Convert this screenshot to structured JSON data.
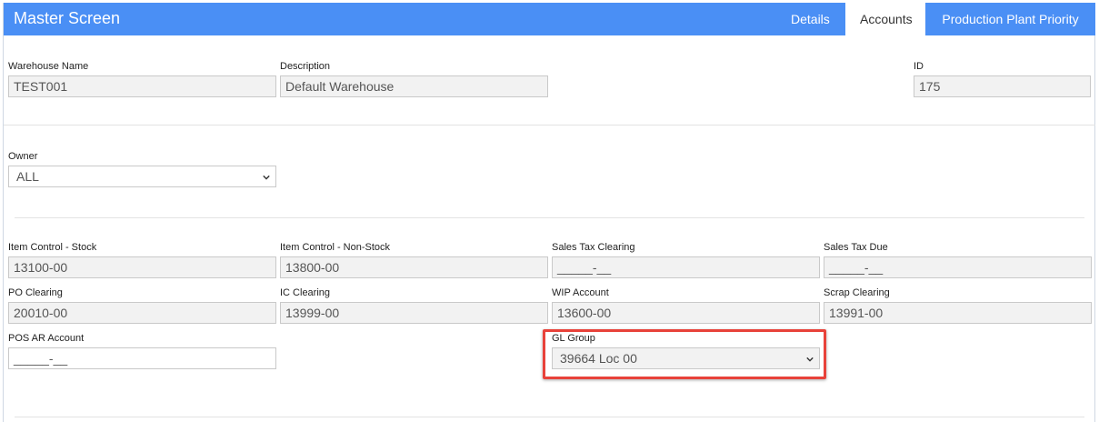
{
  "header": {
    "title": "Master Screen"
  },
  "tabs": [
    {
      "label": "Details",
      "active": false
    },
    {
      "label": "Accounts",
      "active": true
    },
    {
      "label": "Production Plant Priority",
      "active": false
    }
  ],
  "warehouse": {
    "name_label": "Warehouse Name",
    "name_value": "TEST001",
    "desc_label": "Description",
    "desc_value": "Default Warehouse",
    "id_label": "ID",
    "id_value": "175"
  },
  "owner": {
    "label": "Owner",
    "value": "ALL"
  },
  "accounts": {
    "item_stock_label": "Item Control - Stock",
    "item_stock_value": "13100-00",
    "item_nonstock_label": "Item Control - Non-Stock",
    "item_nonstock_value": "13800-00",
    "sales_tax_clearing_label": "Sales Tax Clearing",
    "sales_tax_clearing_value": "_____-__",
    "sales_tax_due_label": "Sales Tax Due",
    "sales_tax_due_value": "_____-__",
    "po_clearing_label": "PO Clearing",
    "po_clearing_value": "20010-00",
    "ic_clearing_label": "IC Clearing",
    "ic_clearing_value": "13999-00",
    "wip_label": "WIP Account",
    "wip_value": "13600-00",
    "scrap_label": "Scrap Clearing",
    "scrap_value": "13991-00",
    "pos_ar_label": "POS AR Account",
    "pos_ar_value": "_____-__",
    "gl_group_label": "GL Group",
    "gl_group_value": "39664 Loc 00"
  },
  "colors": {
    "header": "#4a8ff5",
    "highlight": "#e8423a"
  },
  "icons": {
    "select_arrow": "chevron-down-icon"
  }
}
